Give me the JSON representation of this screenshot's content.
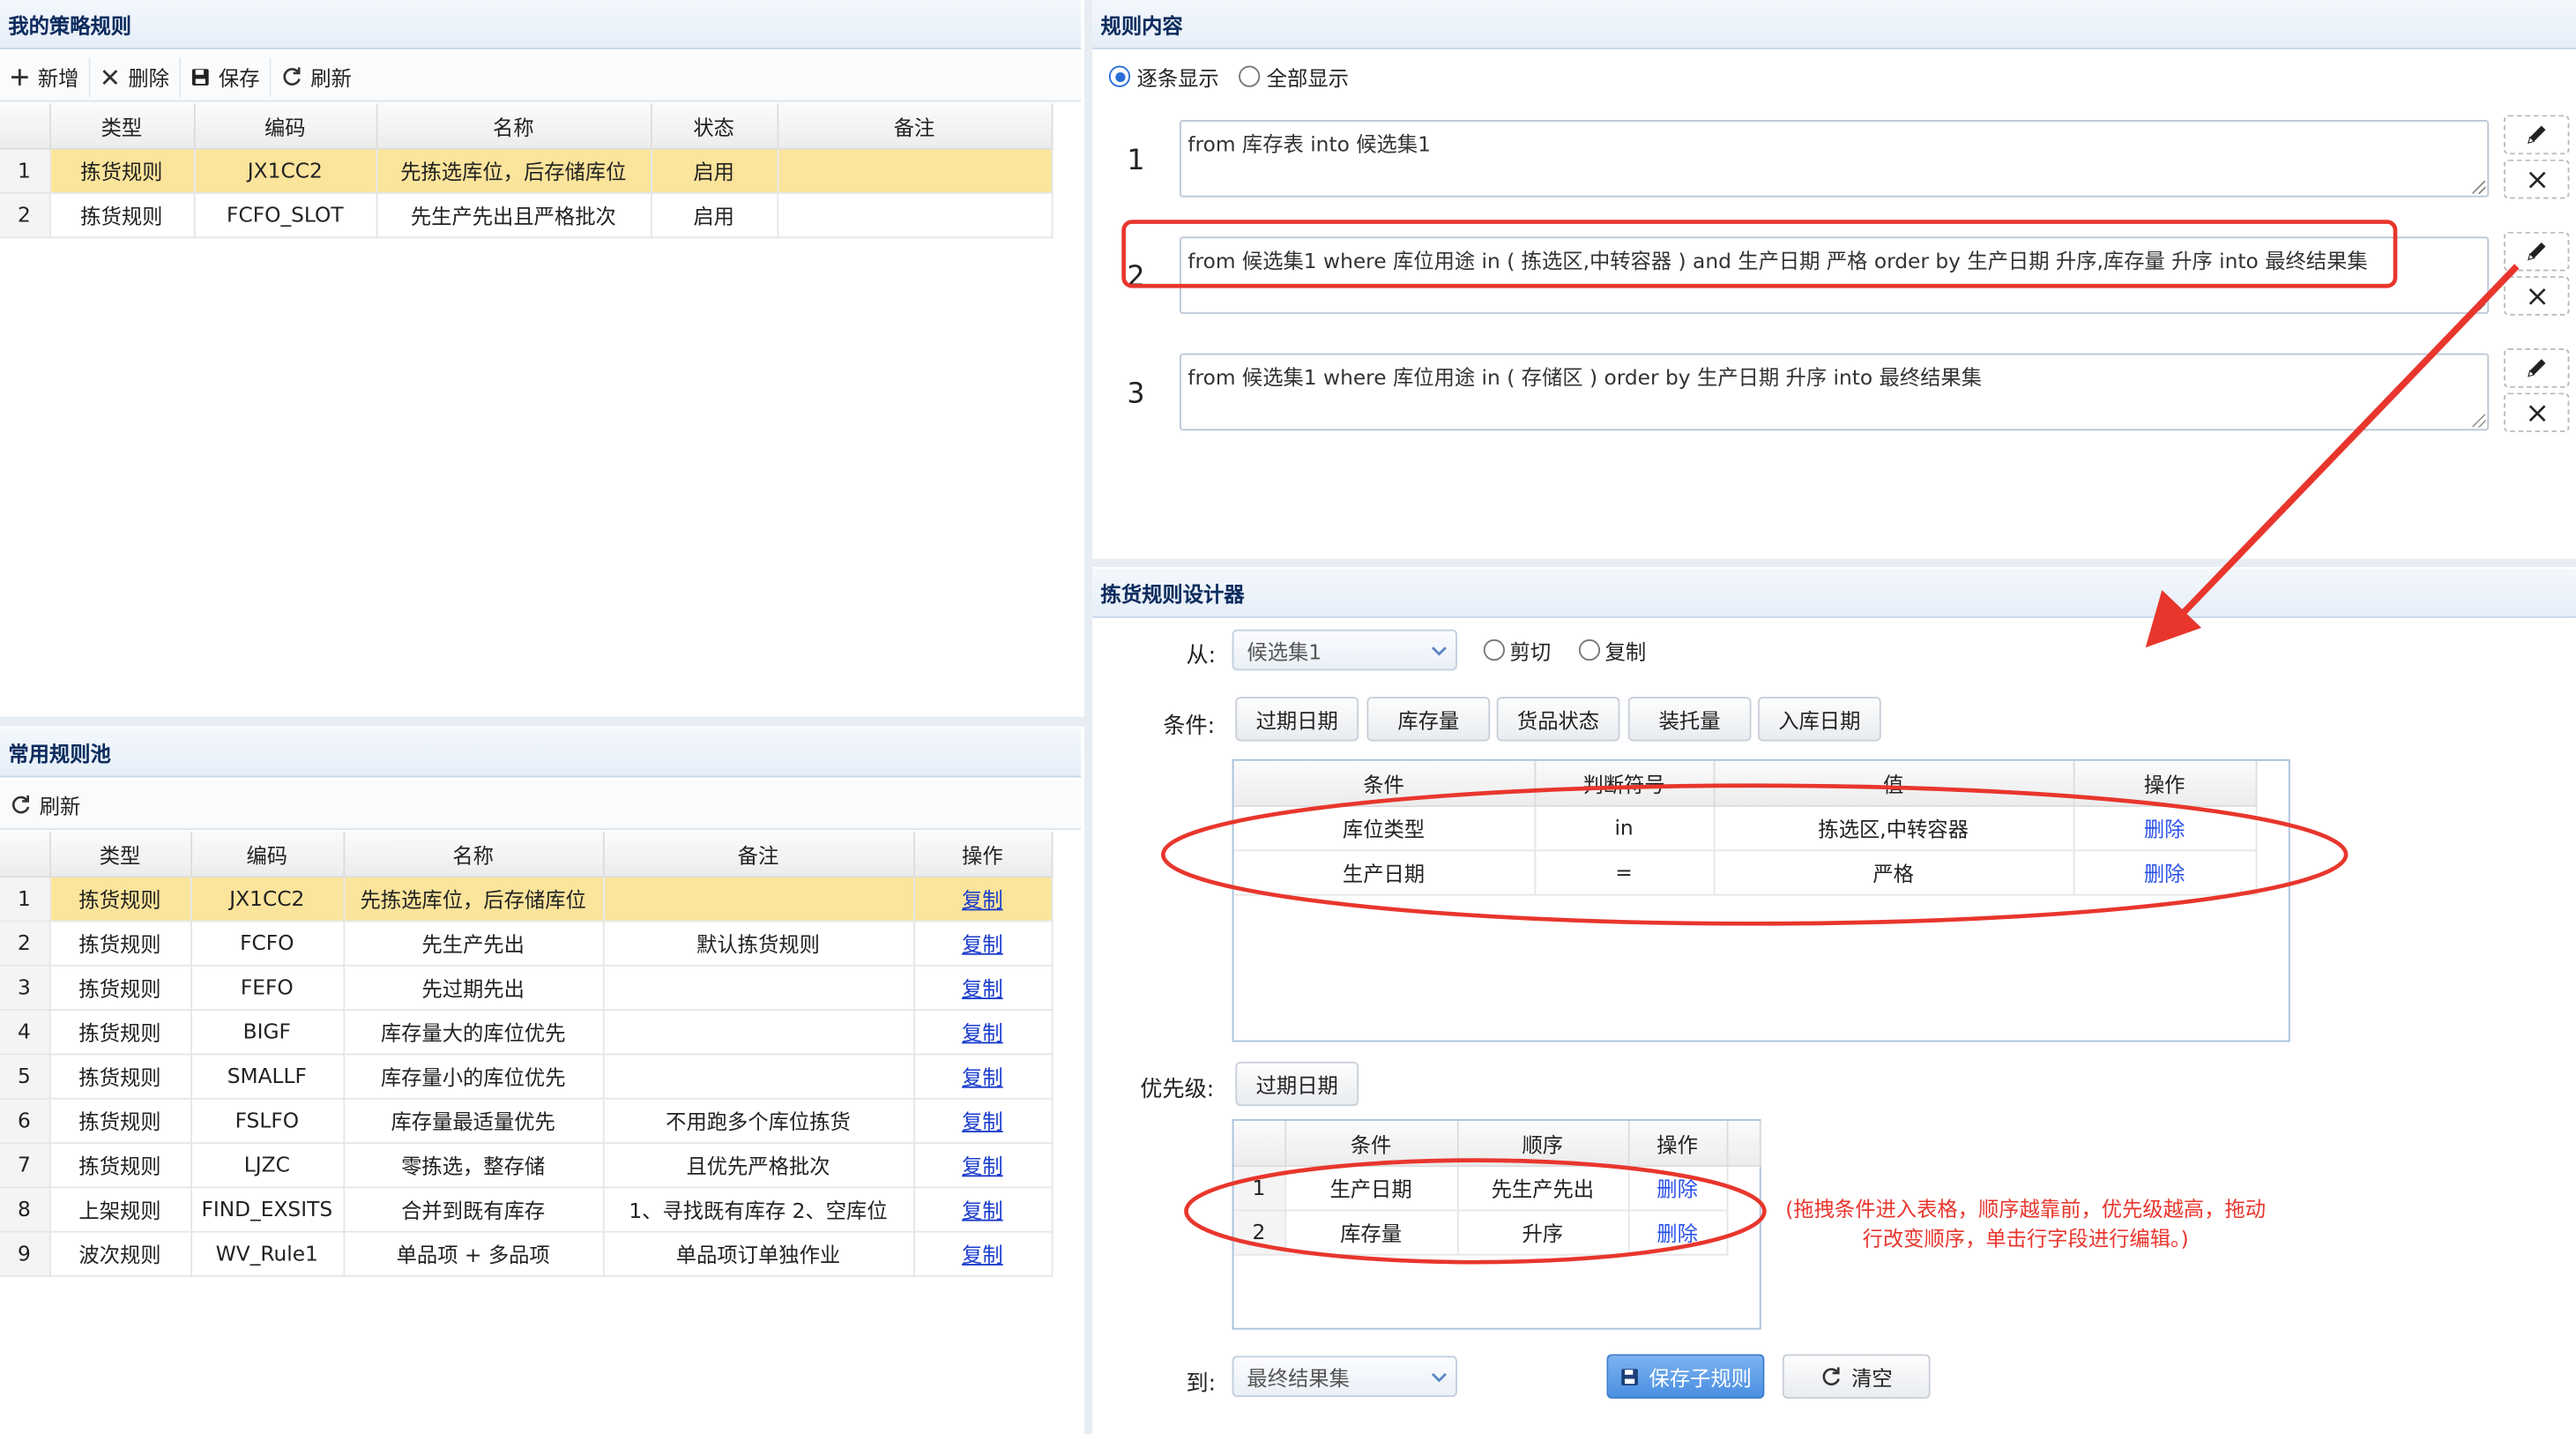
{
  "my_rules": {
    "title": "我的策略规则",
    "toolbar": {
      "add": "新增",
      "delete": "删除",
      "save": "保存",
      "refresh": "刷新"
    },
    "columns": [
      "类型",
      "编码",
      "名称",
      "状态",
      "备注"
    ],
    "rows": [
      {
        "n": "1",
        "type": "拣货规则",
        "code": "JX1CC2",
        "name": "先拣选库位，后存储库位",
        "status": "启用",
        "remark": ""
      },
      {
        "n": "2",
        "type": "拣货规则",
        "code": "FCFO_SLOT",
        "name": "先生产先出且严格批次",
        "status": "启用",
        "remark": ""
      }
    ]
  },
  "common_pool": {
    "title": "常用规则池",
    "refresh": "刷新",
    "columns": [
      "类型",
      "编码",
      "名称",
      "备注",
      "操作"
    ],
    "rows": [
      {
        "n": "1",
        "type": "拣货规则",
        "code": "JX1CC2",
        "name": "先拣选库位，后存储库位",
        "remark": "",
        "op": "复制"
      },
      {
        "n": "2",
        "type": "拣货规则",
        "code": "FCFO",
        "name": "先生产先出",
        "remark": "默认拣货规则",
        "op": "复制"
      },
      {
        "n": "3",
        "type": "拣货规则",
        "code": "FEFO",
        "name": "先过期先出",
        "remark": "",
        "op": "复制"
      },
      {
        "n": "4",
        "type": "拣货规则",
        "code": "BIGF",
        "name": "库存量大的库位优先",
        "remark": "",
        "op": "复制"
      },
      {
        "n": "5",
        "type": "拣货规则",
        "code": "SMALLF",
        "name": "库存量小的库位优先",
        "remark": "",
        "op": "复制"
      },
      {
        "n": "6",
        "type": "拣货规则",
        "code": "FSLFO",
        "name": "库存量最适量优先",
        "remark": "不用跑多个库位拣货",
        "op": "复制"
      },
      {
        "n": "7",
        "type": "拣货规则",
        "code": "LJZC",
        "name": "零拣选，整存储",
        "remark": "且优先严格批次",
        "op": "复制"
      },
      {
        "n": "8",
        "type": "上架规则",
        "code": "FIND_EXSITS",
        "name": "合并到既有库存",
        "remark": "1、寻找既有库存 2、空库位",
        "op": "复制"
      },
      {
        "n": "9",
        "type": "波次规则",
        "code": "WV_Rule1",
        "name": "单品项 + 多品项",
        "remark": "单品项订单独作业",
        "op": "复制"
      }
    ]
  },
  "rule_content": {
    "title": "规则内容",
    "mode_stepwise": "逐条显示",
    "mode_all": "全部显示",
    "lines": [
      {
        "n": "1",
        "text": "from 库存表 into 候选集1"
      },
      {
        "n": "2",
        "text": "from  候选集1 where 库位用途 in ( 拣选区,中转容器 ) and 生产日期 严格 order by 生产日期 升序,库存量 升序 into 最终结果集"
      },
      {
        "n": "3",
        "text": "from  候选集1 where 库位用途 in ( 存储区 ) order by 生产日期 升序 into 最终结果集"
      }
    ]
  },
  "designer": {
    "title": "拣货规则设计器",
    "from_label": "从:",
    "from_value": "候选集1",
    "cut": "剪切",
    "copy": "复制",
    "cond_label": "条件:",
    "cond_chips": [
      "过期日期",
      "库存量",
      "货品状态",
      "装托量",
      "入库日期"
    ],
    "cond_columns": [
      "条件",
      "判断符号",
      "值",
      "操作"
    ],
    "cond_rows": [
      {
        "cond": "库位类型",
        "op": "in",
        "val": "拣选区,中转容器",
        "act": "删除"
      },
      {
        "cond": "生产日期",
        "op": "=",
        "val": "严格",
        "act": "删除"
      }
    ],
    "prio_label": "优先级:",
    "prio_chips": [
      "过期日期"
    ],
    "prio_columns": [
      "条件",
      "顺序",
      "操作"
    ],
    "prio_rows": [
      {
        "n": "1",
        "cond": "生产日期",
        "order": "先生产先出",
        "act": "删除"
      },
      {
        "n": "2",
        "cond": "库存量",
        "order": "升序",
        "act": "删除"
      }
    ],
    "note": "(拖拽条件进入表格，顺序越靠前，优先级越高，拖动行改变顺序，单击行字段进行编辑。)",
    "to_label": "到:",
    "to_value": "最终结果集",
    "save_btn": "保存子规则",
    "clear_btn": "清空"
  },
  "colors": {
    "accent": "#2a6fd6",
    "annotation": "#e8362d",
    "selected_row": "#fbe49b",
    "primary_button": "#5a9ae6"
  }
}
